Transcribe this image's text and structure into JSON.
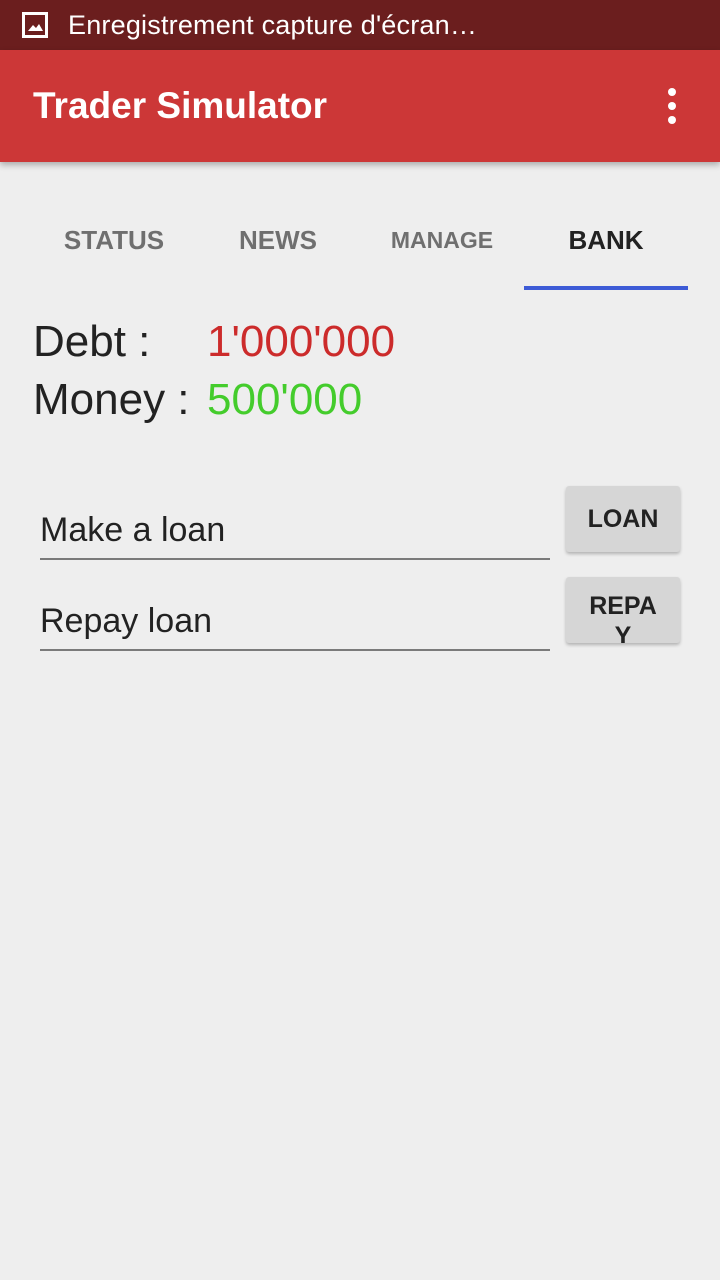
{
  "status_bar": {
    "notification_icon": "image-icon",
    "text": "Enregistrement capture d'écran…",
    "background_color": "#6b1e1e"
  },
  "app_bar": {
    "title": "Trader Simulator",
    "menu_icon": "more-vert-icon",
    "background_color": "#cc3737"
  },
  "tabs": [
    {
      "label": "STATUS",
      "active": false
    },
    {
      "label": "NEWS",
      "active": false
    },
    {
      "label": "MANAGE",
      "active": false
    },
    {
      "label": "BANK",
      "active": true
    }
  ],
  "tab_indicator_color": "#3d5bd6",
  "bank": {
    "debt_label": "Debt :",
    "debt_value": "1'000'000",
    "debt_color": "#cc2b2b",
    "money_label": "Money :",
    "money_value": "500'000",
    "money_color": "#44cc2c"
  },
  "loan": {
    "input_text": "Make a loan",
    "button_label": "LOAN"
  },
  "repay": {
    "input_text": "Repay loan",
    "button_label": "REPAY"
  }
}
